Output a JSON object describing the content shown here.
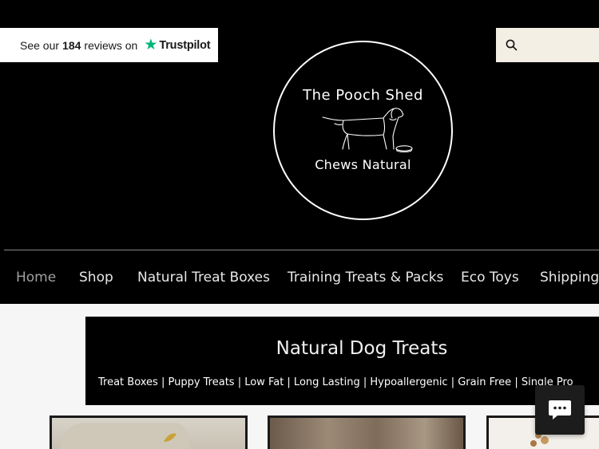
{
  "trustpilot": {
    "prefix": "See our",
    "count": "184",
    "suffix": "reviews on",
    "brand": "Trustpilot",
    "star": "★"
  },
  "search": {
    "placeholder": "",
    "icon": "search-icon"
  },
  "logo": {
    "line1": "The Pooch Shed",
    "line2": "Chews Natural",
    "icon": "dog-icon"
  },
  "nav": {
    "items": [
      {
        "label": "Home",
        "active": true
      },
      {
        "label": "Shop"
      },
      {
        "label": "Natural Treat Boxes"
      },
      {
        "label": "Training Treats & Packs"
      },
      {
        "label": "Eco Toys"
      },
      {
        "label": "Shipping"
      }
    ]
  },
  "banner": {
    "title": "Natural Dog Treats",
    "categories": "Treat Boxes |  Puppy Treats |  Low Fat  | Long Lasting |  Hypoallergenic | Grain Free | Single Pro"
  },
  "chat": {
    "icon": "chat-icon"
  },
  "colors": {
    "background": "#000000",
    "search_bg": "#f3efe4",
    "trustpilot_green": "#00b67a",
    "content_bg": "#f6f6f6"
  }
}
